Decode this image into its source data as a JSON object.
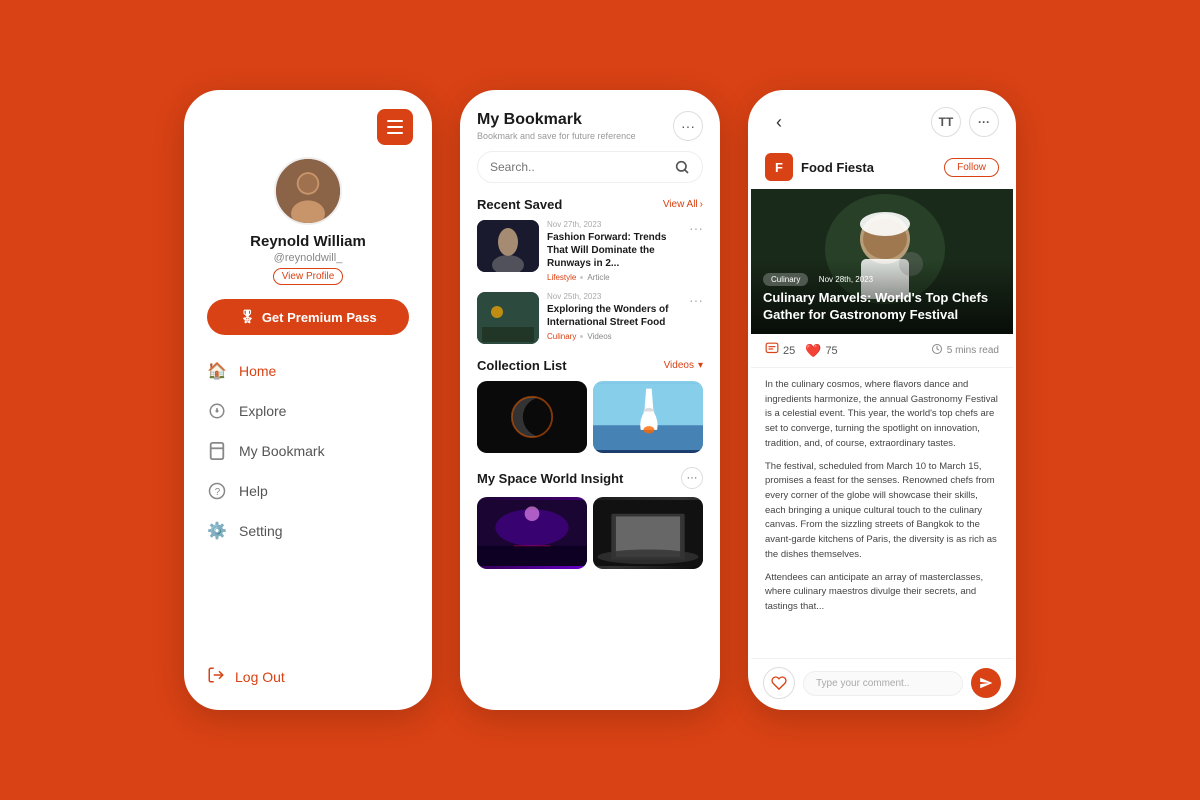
{
  "background": "#D94214",
  "phone1": {
    "menu_icon": "☰",
    "user_name": "Reynold William",
    "user_handle": "@reynoldwill_",
    "view_profile": "View Profile",
    "premium_btn": "Get Premium Pass",
    "nav": [
      {
        "id": "home",
        "label": "Home",
        "icon": "🏠",
        "active": true
      },
      {
        "id": "explore",
        "label": "Explore",
        "icon": "🔍",
        "active": false
      },
      {
        "id": "bookmark",
        "label": "My Bookmark",
        "icon": "🔖",
        "active": false
      },
      {
        "id": "help",
        "label": "Help",
        "icon": "❓",
        "active": false
      },
      {
        "id": "setting",
        "label": "Setting",
        "icon": "⚙️",
        "active": false
      }
    ],
    "logout": "Log Out"
  },
  "phone2": {
    "title": "My Bookmark",
    "subtitle": "Bookmark and save for future reference",
    "search_placeholder": "Search..",
    "recent_saved": "Recent Saved",
    "view_all": "View All",
    "items": [
      {
        "date": "Nov 27th, 2023",
        "title": "Fashion Forward: Trends That Will Dominate the Runways in 2...",
        "tag1": "Lifestyle",
        "tag2": "Article"
      },
      {
        "date": "Nov 25th, 2023",
        "title": "Exploring the Wonders of International Street Food",
        "tag1": "Culinary",
        "tag2": "Videos"
      }
    ],
    "collection_title": "Collection List",
    "collection_filter": "Videos",
    "space_title": "My Space World Insight"
  },
  "phone3": {
    "back": "‹",
    "font_icon": "TT",
    "more_icon": "···",
    "author_initial": "F",
    "author_name": "Food Fiesta",
    "follow_label": "Follow",
    "hero_badge": "Culinary",
    "hero_date": "Nov 28th, 2023",
    "hero_title": "Culinary Marvels: World's Top Chefs Gather for Gastronomy Festival",
    "comments_count": "25",
    "likes_count": "75",
    "reading_time": "5 mins read",
    "paragraphs": [
      "In the culinary cosmos, where flavors dance and ingredients harmonize, the annual Gastronomy Festival is a celestial event. This year, the world's top chefs are set to converge, turning the spotlight on innovation, tradition, and, of course, extraordinary tastes.",
      "The festival, scheduled from March 10 to March 15, promises a feast for the senses. Renowned chefs from every corner of the globe will showcase their skills, each bringing a unique cultural touch to the culinary canvas. From the sizzling streets of Bangkok to the avant-garde kitchens of Paris, the diversity is as rich as the dishes themselves.",
      "Attendees can anticipate an array of masterclasses, where culinary maestros divulge their secrets, and tastings that..."
    ],
    "comment_placeholder": "Type your comment..",
    "send_icon": "➤"
  }
}
